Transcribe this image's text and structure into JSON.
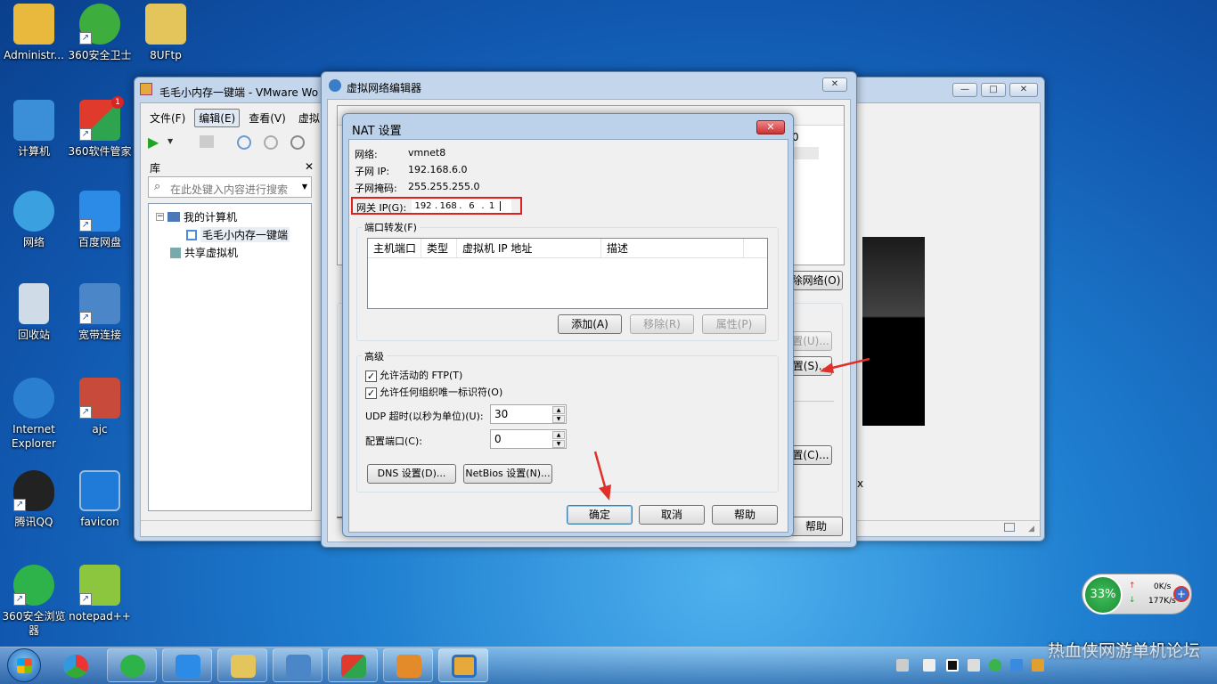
{
  "desktop": {
    "icons": [
      {
        "label": "Administr...",
        "color": "#e8b93c"
      },
      {
        "label": "360安全卫士",
        "color": "#3dae3d"
      },
      {
        "label": "8UFtp",
        "color": "#e3c55c"
      },
      {
        "label": "计算机",
        "color": "#3b8fd8"
      },
      {
        "label": "360软件管家",
        "color": "#e03a2d",
        "badge": "1"
      },
      {
        "label": "网络",
        "color": "#3aa0e0"
      },
      {
        "label": "百度网盘",
        "color": "#2b8be6"
      },
      {
        "label": "回收站",
        "color": "#cfdbe6"
      },
      {
        "label": "宽带连接",
        "color": "#4a86c8"
      },
      {
        "label": "Internet Explorer",
        "color": "#2a7fd0"
      },
      {
        "label": "ajc",
        "color": "#c84a3a"
      },
      {
        "label": "腾讯QQ",
        "color": "#222222"
      },
      {
        "label": "favicon",
        "color": "#1f7ad8"
      },
      {
        "label": "360安全浏览器",
        "color": "#2eb34a"
      },
      {
        "label": "notepad++",
        "color": "#8cc63f"
      }
    ]
  },
  "vmware": {
    "title": "毛毛小内存一键端 - VMware Wo",
    "menu": [
      "文件(F)",
      "编辑(E)",
      "查看(V)",
      "虚拟"
    ],
    "library_label": "库",
    "close_x": "✕",
    "search_placeholder": "在此处键入内容进行搜索",
    "tree": [
      "我的计算机",
      "毛毛小内存一键端",
      "共享虚拟机"
    ]
  },
  "vne": {
    "title": "虚拟网络编辑器",
    "frag_0": "0",
    "btn_network": "除网络(O)",
    "btn_u": "置(U)...",
    "btn_s": "置(S)...",
    "btn_c": "置(C)...",
    "btn_help": "帮助",
    "frag_x": "x"
  },
  "nat": {
    "title": "NAT 设置",
    "network_label": "网络:",
    "network_value": "vmnet8",
    "subnet_ip_label": "子网 IP:",
    "subnet_ip_value": "192.168.6.0",
    "subnet_mask_label": "子网掩码:",
    "subnet_mask_value": "255.255.255.0",
    "gateway_label": "网关 IP(G):",
    "gateway_octets": [
      "192",
      "168",
      "6",
      "1"
    ],
    "port_forward_title": "端口转发(F)",
    "columns": [
      "主机端口",
      "类型",
      "虚拟机 IP 地址",
      "描述"
    ],
    "btn_add": "添加(A)",
    "btn_remove": "移除(R)",
    "btn_props": "属性(P)",
    "advanced_title": "高级",
    "chk_ftp": "允许活动的 FTP(T)",
    "chk_oui": "允许任何组织唯一标识符(O)",
    "udp_label": "UDP 超时(以秒为单位)(U):",
    "udp_value": "30",
    "cfg_port_label": "配置端口(C):",
    "cfg_port_value": "0",
    "btn_dns": "DNS 设置(D)...",
    "btn_netbios": "NetBios 设置(N)...",
    "btn_ok": "确定",
    "btn_cancel": "取消",
    "btn_help": "帮助"
  },
  "network_widget": {
    "percent": "33%",
    "up": "0K/s",
    "down": "177K/s"
  },
  "watermark": "热血侠网游单机论坛",
  "colors": {
    "highlight": "#e02020",
    "arrow": "#e0302a"
  }
}
